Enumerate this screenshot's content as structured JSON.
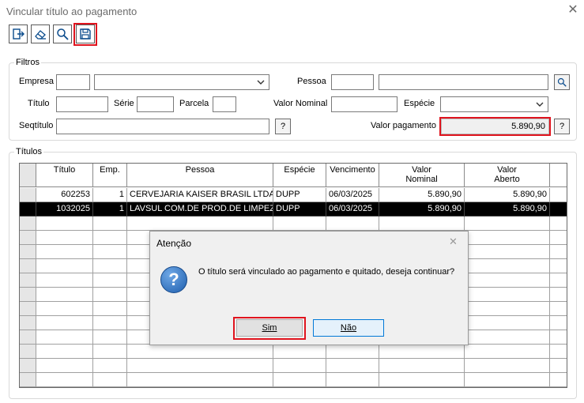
{
  "window": {
    "title": "Vincular título ao pagamento",
    "close_glyph": "✕"
  },
  "toolbar": {
    "buttons": [
      {
        "name": "exit-icon"
      },
      {
        "name": "eraser-icon"
      },
      {
        "name": "search-icon"
      },
      {
        "name": "save-icon"
      }
    ]
  },
  "filters": {
    "legend": "Filtros",
    "empresa_label": "Empresa",
    "pessoa_label": "Pessoa",
    "titulo_label": "Título",
    "serie_label": "Série",
    "parcela_label": "Parcela",
    "valor_nominal_label": "Valor Nominal",
    "especie_label": "Espécie",
    "seqtitulo_label": "Seqtítulo",
    "valor_pagamento_label": "Valor pagamento",
    "valor_pagamento_value": "5.890,90",
    "help_glyph": "?"
  },
  "titulos": {
    "legend": "Títulos",
    "columns": [
      "Título",
      "Emp.",
      "Pessoa",
      "Espécie",
      "Vencimento",
      "Valor\nNominal",
      "Valor\nAberto"
    ],
    "rows": [
      [
        "602253",
        "1",
        "CERVEJARIA KAISER BRASIL LTDA",
        "DUPP",
        "06/03/2025",
        "5.890,90",
        "5.890,90"
      ],
      [
        "1032025",
        "1",
        "LAVSUL COM.DE PROD.DE LIMPEZ",
        "DUPP",
        "06/03/2025",
        "5.890,90",
        "5.890,90"
      ]
    ]
  },
  "dialog": {
    "title": "Atenção",
    "message": "O título será vinculado ao pagamento e quitado, deseja continuar?",
    "yes_label": "Sim",
    "no_label": "Não",
    "icon_glyph": "?",
    "close_glyph": "✕"
  }
}
